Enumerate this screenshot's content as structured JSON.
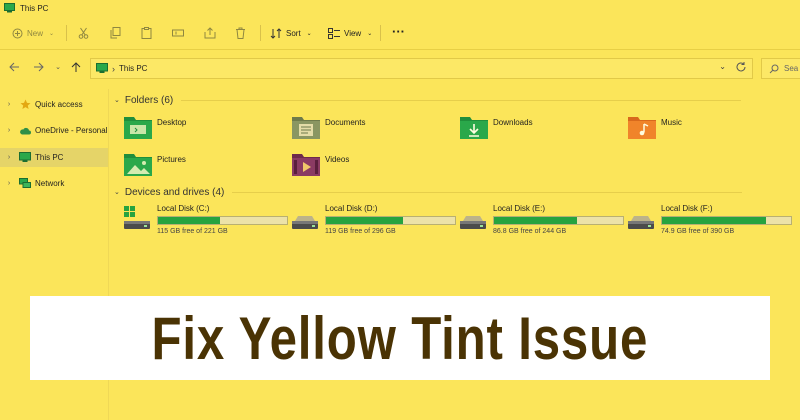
{
  "window": {
    "title": "This PC"
  },
  "toolbar": {
    "new_label": "New",
    "sort_label": "Sort",
    "view_label": "View",
    "more_label": "···"
  },
  "address": {
    "location": "This PC",
    "search_placeholder": "Sea"
  },
  "nav": {
    "items": [
      {
        "label": "Quick access",
        "icon": "star-icon"
      },
      {
        "label": "OneDrive - Personal",
        "icon": "cloud-icon"
      },
      {
        "label": "This PC",
        "icon": "monitor-icon",
        "selected": true
      },
      {
        "label": "Network",
        "icon": "network-icon"
      }
    ]
  },
  "folders": {
    "header": "Folders (6)",
    "items": [
      {
        "label": "Desktop",
        "icon": "desktop-folder-icon",
        "color": "#2aa84a"
      },
      {
        "label": "Documents",
        "icon": "documents-folder-icon",
        "color": "#7d8a5b"
      },
      {
        "label": "Downloads",
        "icon": "downloads-folder-icon",
        "color": "#2aa84a"
      },
      {
        "label": "Music",
        "icon": "music-folder-icon",
        "color": "#f0842a"
      },
      {
        "label": "Pictures",
        "icon": "pictures-folder-icon",
        "color": "#2aa84a"
      },
      {
        "label": "Videos",
        "icon": "videos-folder-icon",
        "color": "#8a3b63"
      }
    ]
  },
  "drives": {
    "header": "Devices and drives (4)",
    "items": [
      {
        "name": "Local Disk (C:)",
        "free": "115 GB free of 221 GB",
        "used_fraction": 0.48,
        "system": true
      },
      {
        "name": "Local Disk (D:)",
        "free": "119 GB free of 296 GB",
        "used_fraction": 0.6,
        "system": false
      },
      {
        "name": "Local Disk (E:)",
        "free": "86.8 GB free of 244 GB",
        "used_fraction": 0.64,
        "system": false
      },
      {
        "name": "Local Disk (F:)",
        "free": "74.9 GB free of 390 GB",
        "used_fraction": 0.81,
        "system": false
      }
    ]
  },
  "banner": {
    "text": "Fix Yellow Tint Issue"
  },
  "colors": {
    "tint": "#fbe55a",
    "drive_bar": "#26a33f",
    "banner_text": "#4a3304"
  }
}
